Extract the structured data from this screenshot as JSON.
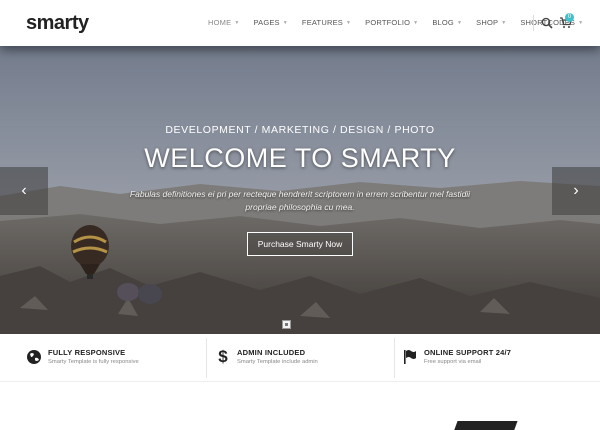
{
  "header": {
    "logo": "smarty",
    "nav": [
      {
        "label": "HOME"
      },
      {
        "label": "PAGES"
      },
      {
        "label": "FEATURES"
      },
      {
        "label": "PORTFOLIO"
      },
      {
        "label": "BLOG"
      },
      {
        "label": "SHOP"
      },
      {
        "label": "SHORTCODES"
      }
    ],
    "cart_count": "0",
    "search_icon": "search-icon",
    "cart_icon": "cart-icon"
  },
  "hero": {
    "subtitle": "DEVELOPMENT / MARKETING / DESIGN / PHOTO",
    "title": "WELCOME TO SMARTY",
    "text": "Fabulas definitiones ei pri per recteque hendrerit scriptorem in errem scribentur mel fastidii propriae philosophia cu mea.",
    "button": "Purchase Smarty Now",
    "prev_icon": "chevron-left-icon",
    "next_icon": "chevron-right-icon"
  },
  "features": [
    {
      "icon": "globe-icon",
      "title": "FULLY RESPONSIVE",
      "subtitle": "Smarty Template is fully responsive"
    },
    {
      "icon": "dollar-icon",
      "title": "ADMIN INCLUDED",
      "subtitle": "Smarty Template include admin"
    },
    {
      "icon": "flag-icon",
      "title": "ONLINE SUPPORT 24/7",
      "subtitle": "Free support via email"
    }
  ],
  "colors": {
    "accent": "#3fc1c9",
    "text_dark": "#222222"
  }
}
